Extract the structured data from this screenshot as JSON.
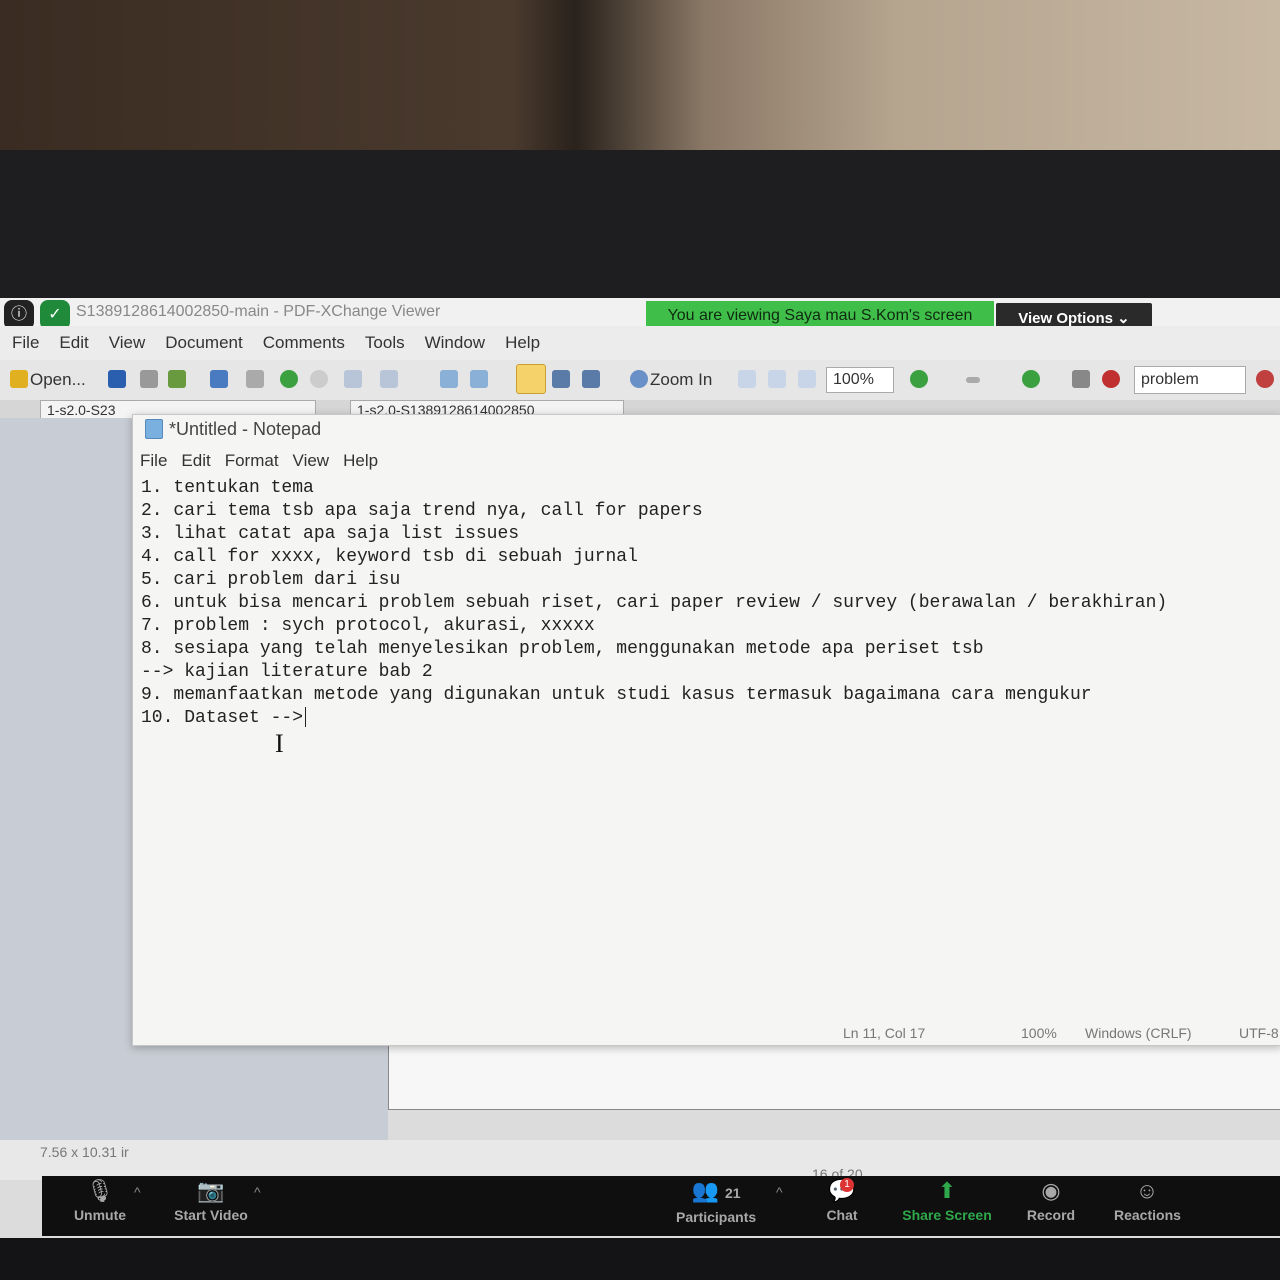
{
  "pdf_viewer": {
    "window_title": "S1389128614002850-main - PDF-XChange Viewer",
    "menu": [
      "File",
      "Edit",
      "View",
      "Document",
      "Comments",
      "Tools",
      "Window",
      "Help"
    ],
    "toolbar": {
      "open_label": "Open...",
      "zoom_in_label": "Zoom In",
      "zoom_value": "100%",
      "search_value": "problem"
    },
    "tabs": [
      "1-s2.0-S23",
      "1-s2.0-S1389128614002850"
    ],
    "page_size": "7.56 x 10.31 ir",
    "page_nav": "16 of 20"
  },
  "zoom_meeting": {
    "sharing_banner": "You are viewing Saya mau S.Kom's screen",
    "view_options_label": "View Options",
    "controls": {
      "unmute": "Unmute",
      "start_video": "Start Video",
      "participants": "Participants",
      "participants_count": "21",
      "chat": "Chat",
      "chat_badge": "1",
      "share_screen": "Share Screen",
      "record": "Record",
      "reactions": "Reactions"
    }
  },
  "notepad": {
    "title": "*Untitled - Notepad",
    "menu": [
      "File",
      "Edit",
      "Format",
      "View",
      "Help"
    ],
    "lines": [
      "1. tentukan tema",
      "2. cari tema tsb apa saja trend nya, call for papers",
      "3. lihat catat apa saja list issues",
      "4. call for xxxx, keyword tsb di sebuah jurnal",
      "5. cari problem dari isu",
      "6. untuk bisa mencari problem sebuah riset, cari paper review / survey (berawalan / berakhiran)",
      "7. problem : sych protocol, akurasi, xxxxx",
      "8. sesiapa yang telah menyelesikan problem, menggunakan metode apa periset tsb",
      "--> kajian literature bab 2",
      "9. memanfaatkan metode yang digunakan untuk studi kasus termasuk bagaimana cara mengukur",
      "10. Dataset -->"
    ],
    "status": {
      "position": "Ln 11, Col 17",
      "zoom": "100%",
      "line_endings": "Windows (CRLF)",
      "encoding": "UTF-8"
    }
  }
}
